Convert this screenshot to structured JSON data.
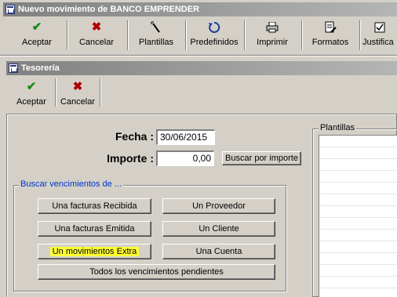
{
  "window": {
    "title": "Nuevo movimiento de BANCO EMPRENDER"
  },
  "main_toolbar": {
    "items": [
      {
        "label": "Aceptar",
        "icon": "check-icon"
      },
      {
        "label": "Cancelar",
        "icon": "cross-icon"
      },
      {
        "label": "Plantillas",
        "icon": "wand-icon"
      },
      {
        "label": "Predefinidos",
        "icon": "refresh-icon"
      },
      {
        "label": "Imprimir",
        "icon": "printer-icon"
      },
      {
        "label": "Formatos",
        "icon": "document-edit-icon"
      },
      {
        "label": "Justifica",
        "icon": "checkbox-icon"
      }
    ]
  },
  "subwindow": {
    "title": "Tesorería"
  },
  "sub_toolbar": {
    "items": [
      {
        "label": "Aceptar",
        "icon": "check-icon"
      },
      {
        "label": "Cancelar",
        "icon": "cross-icon"
      }
    ]
  },
  "form": {
    "fecha_label": "Fecha :",
    "fecha_value": "30/06/2015",
    "importe_label": "Importe :",
    "importe_value": "0,00",
    "buscar_importe": "Buscar por importe"
  },
  "search_group": {
    "title": "Buscar vencimientos de ...",
    "buttons": [
      "Una facturas Recibida",
      "Un Proveedor",
      "Una facturas Emitida",
      "Un Cliente",
      "Un movimientos Extra",
      "Una Cuenta",
      "Todos los vencimientos pendientes"
    ]
  },
  "plantillas_panel": {
    "title": "Plantillas"
  },
  "colors": {
    "highlight": "#ffff33",
    "group_title": "#0033cc",
    "accept": "#1a8a1a",
    "cancel": "#b00000"
  }
}
